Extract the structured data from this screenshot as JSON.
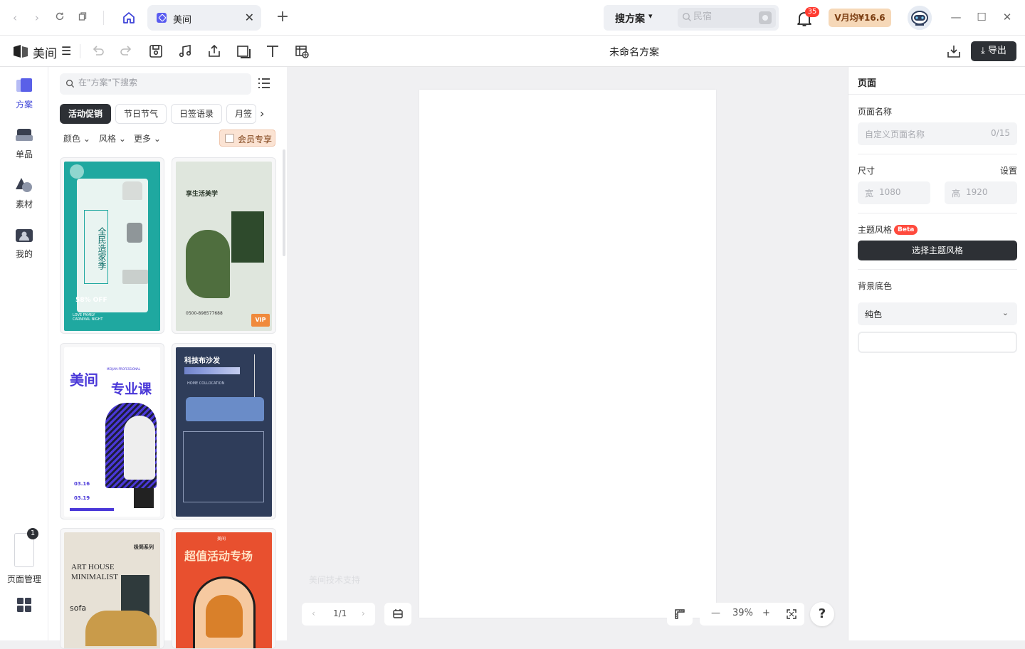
{
  "titlebar": {
    "tab_label": "美间",
    "search_scope": "搜方案",
    "search_placeholder": "民宿",
    "notification_count": "35",
    "vip_label": "V月均¥16.6"
  },
  "toolbar": {
    "logo_text": "美间",
    "document_title": "未命名方案",
    "export_label": "⤓ 导出"
  },
  "left_rail": {
    "items": [
      {
        "label": "方案"
      },
      {
        "label": "单品"
      },
      {
        "label": "素材"
      },
      {
        "label": "我的"
      }
    ],
    "page_count_badge": "1",
    "page_manager_label": "页面管理"
  },
  "panel": {
    "search_placeholder": "在\"方案\"下搜索",
    "chips": [
      "活动促销",
      "节日节气",
      "日签语录",
      "月签"
    ],
    "filters": [
      "颜色",
      "风格",
      "更多"
    ],
    "member_only_label": "会员专享",
    "templates": [
      {
        "title": "全民造家季",
        "subtitle": "58% OFF",
        "footer": "LOVE FAMILY CARNIVAL NIGHT"
      },
      {
        "title": "享生活美学",
        "badge": "VIP",
        "phone": "0500-898577688"
      },
      {
        "title": "美间",
        "subtitle": "专业课",
        "tag": "MEIJIAN PROFESSIONAL",
        "dates": [
          "03.16",
          "03.19"
        ]
      },
      {
        "title": "科技布沙发",
        "subtitle": "HOME COLLOCATION"
      },
      {
        "title": "ART HOUSE MINIMALIST",
        "tag": "极简系列",
        "sub": "sofa"
      },
      {
        "title": "超值活动专场",
        "tag": "美间"
      }
    ]
  },
  "canvas": {
    "watermark": "美间技术支持",
    "pager_text": "1/1",
    "zoom_level": "39%"
  },
  "right_panel": {
    "header": "页面",
    "page_name_label": "页面名称",
    "page_name_placeholder": "自定义页面名称",
    "page_name_counter": "0/15",
    "size_label": "尺寸",
    "size_settings": "设置",
    "width_label": "宽",
    "width_value": "1080",
    "height_label": "高",
    "height_value": "1920",
    "theme_label": "主题风格",
    "beta_label": "Beta",
    "theme_button": "选择主题风格",
    "bg_label": "背景底色",
    "bg_mode": "纯色"
  },
  "colors": {
    "accent": "#3d43d8",
    "dark_button": "#2d3035",
    "vip_bg": "#f6d8b8",
    "badge_red": "#ff3b30"
  }
}
